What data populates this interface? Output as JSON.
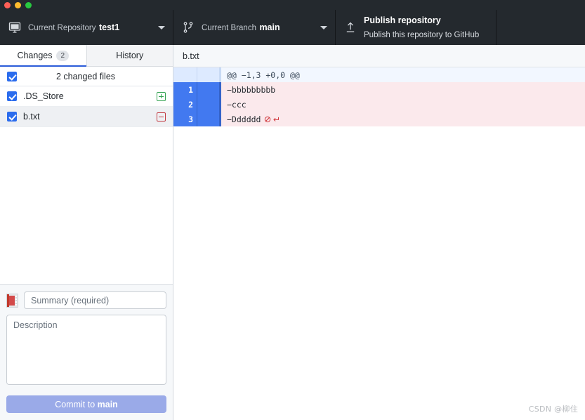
{
  "window": {
    "traffic_lights": [
      "close",
      "minimize",
      "zoom"
    ],
    "colors": {
      "toolbar_bg": "#24292e",
      "accent_blue": "#2b5cd9",
      "checkbox_blue": "#2b6ced",
      "diff_add_green": "#34a352",
      "diff_del_red": "#c23b42",
      "gutter_blue": "#4279f0",
      "del_line_bg": "#fbe9ec",
      "hunk_bg": "#f2f7ff",
      "commit_button_bg": "#9aaae8"
    }
  },
  "toolbar": {
    "repository": {
      "icon": "desktop-monitor-icon",
      "label": "Current Repository",
      "value": "test1",
      "caret": "chevron-down-icon"
    },
    "branch": {
      "icon": "git-branch-icon",
      "label": "Current Branch",
      "value": "main",
      "caret": "chevron-down-icon"
    },
    "publish": {
      "icon": "upload-icon",
      "title": "Publish repository",
      "subtitle": "Publish this repository to GitHub"
    }
  },
  "sidebar": {
    "tabs": [
      {
        "label": "Changes",
        "badge": "2",
        "active": true
      },
      {
        "label": "History",
        "badge": "",
        "active": false
      }
    ],
    "changed_header": {
      "checkbox_checked": true,
      "label": "2 changed files"
    },
    "files": [
      {
        "name": ".DS_Store",
        "checked": true,
        "status": "added",
        "status_symbol": "+",
        "selected": false
      },
      {
        "name": "b.txt",
        "checked": true,
        "status": "deleted",
        "status_symbol": "−",
        "selected": true
      }
    ]
  },
  "commit_form": {
    "avatar": "user-avatar-placeholder",
    "summary_placeholder": "Summary (required)",
    "summary_value": "",
    "description_placeholder": "Description",
    "description_value": "",
    "commit_button_prefix": "Commit to ",
    "commit_button_branch": "main"
  },
  "diff": {
    "file_header": "b.txt",
    "lines": [
      {
        "kind": "hunk",
        "line_number": "",
        "text": "@@ −1,3 +0,0 @@",
        "eol_marks": []
      },
      {
        "kind": "deletion",
        "line_number": "1",
        "text": "−bbbbbbbbb",
        "eol_marks": []
      },
      {
        "kind": "deletion",
        "line_number": "2",
        "text": "−ccc",
        "eol_marks": []
      },
      {
        "kind": "deletion",
        "line_number": "3",
        "text": "−Dddddd",
        "eol_marks": [
          "no-newline-icon",
          "carriage-return-icon"
        ]
      }
    ]
  },
  "watermark": {
    "text": "CSDN @柳住"
  }
}
